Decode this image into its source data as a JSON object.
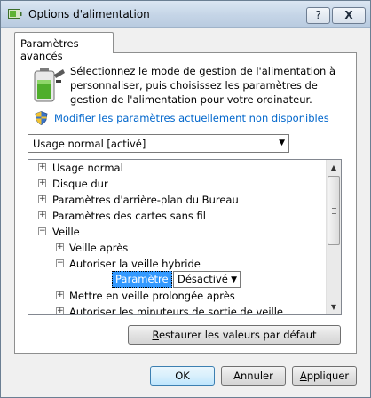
{
  "window": {
    "title": "Options d'alimentation",
    "help_button": "?",
    "close_button": "X"
  },
  "tab": {
    "label": "Paramètres avancés"
  },
  "intro": {
    "text": "Sélectionnez le mode de gestion de l'alimentation à personnaliser, puis choisissez les paramètres de gestion de l'alimentation pour votre ordinateur.",
    "link": "Modifier les paramètres actuellement non disponibles"
  },
  "plan_select": {
    "value": "Usage normal [activé]"
  },
  "tree": {
    "items": [
      {
        "label": "Usage normal",
        "expander": "+"
      },
      {
        "label": "Disque dur",
        "expander": "+"
      },
      {
        "label": "Paramètres d'arrière-plan du Bureau",
        "expander": "+"
      },
      {
        "label": "Paramètres des cartes sans fil",
        "expander": "+"
      },
      {
        "label": "Veille",
        "expander": "−"
      },
      {
        "label": "Veille après",
        "expander": "+"
      },
      {
        "label": "Autoriser la veille hybride",
        "expander": "−"
      },
      {
        "label": "Mettre en veille prolongée après",
        "expander": "+"
      },
      {
        "label": "Autoriser les minuteurs de sortie de veille",
        "expander": "+"
      }
    ],
    "setting": {
      "label": "Paramètre :",
      "value": "Désactivé"
    }
  },
  "buttons": {
    "restore_pre": "",
    "restore_underline": "R",
    "restore_rest": "estaurer les valeurs par défaut",
    "ok": "OK",
    "cancel": "Annuler",
    "apply_underline": "A",
    "apply_rest": "ppliquer"
  }
}
